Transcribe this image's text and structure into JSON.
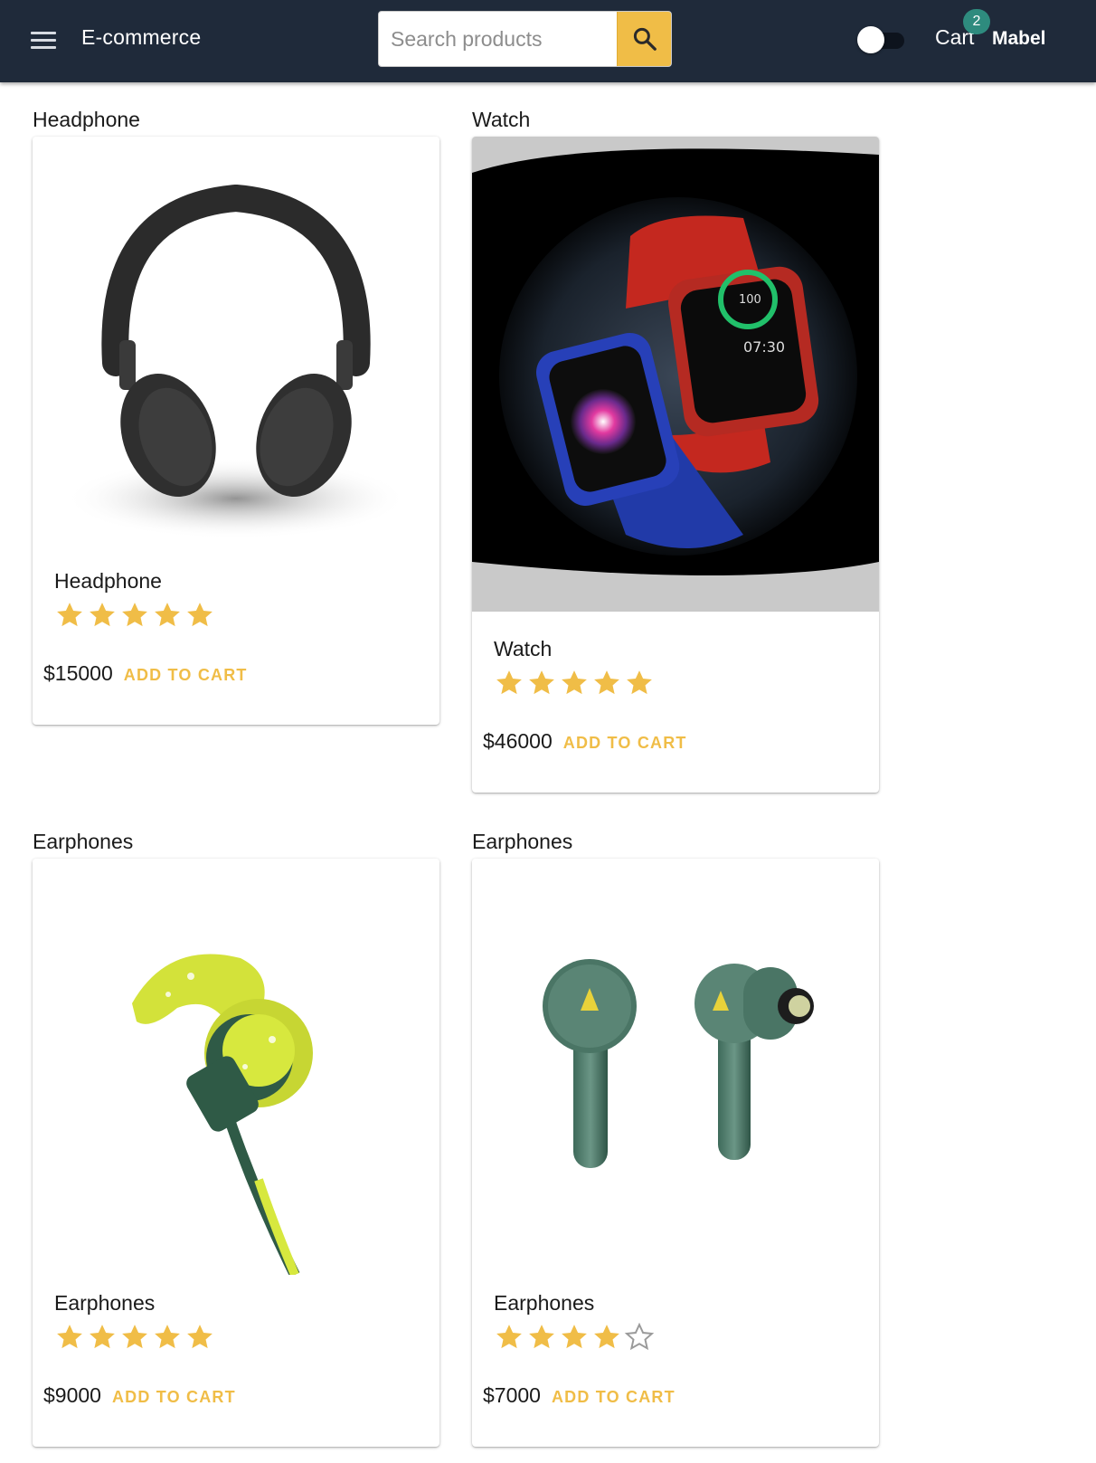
{
  "header": {
    "app_title": "E-commerce",
    "search_placeholder": "Search products",
    "cart_label": "Cart",
    "cart_count": "2",
    "user_name": "Mabel",
    "theme_toggle_on": false,
    "colors": {
      "bar": "#1f2a3a",
      "accent": "#f0bd47",
      "badge": "#2e8b7e"
    }
  },
  "products": [
    {
      "heading": "Headphone",
      "name": "Headphone",
      "rating": 5,
      "max_rating": 5,
      "price": "$15000",
      "action": "ADD TO CART",
      "image_icon": "headphone-image"
    },
    {
      "heading": "Watch",
      "name": "Watch",
      "rating": 5,
      "max_rating": 5,
      "price": "$46000",
      "action": "ADD TO CART",
      "image_icon": "smartwatch-image"
    },
    {
      "heading": "Earphones",
      "name": "Earphones",
      "rating": 5,
      "max_rating": 5,
      "price": "$9000",
      "action": "ADD TO CART",
      "image_icon": "sports-earphone-image"
    },
    {
      "heading": "Earphones",
      "name": "Earphones",
      "rating": 4,
      "max_rating": 5,
      "price": "$7000",
      "action": "ADD TO CART",
      "image_icon": "wireless-earbuds-image"
    }
  ]
}
